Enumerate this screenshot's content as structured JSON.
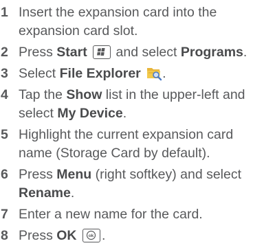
{
  "steps": [
    {
      "num": "1",
      "line1": "Insert the expansion card into the",
      "line2": "expansion card slot."
    },
    {
      "num": "2",
      "pre": "Press ",
      "bold1": "Start",
      "mid": " and select ",
      "bold2": "Programs",
      "post": "."
    },
    {
      "num": "3",
      "pre": "Select ",
      "bold1": "File Explorer",
      "post": "."
    },
    {
      "num": "4",
      "pre": "Tap the ",
      "bold1": "Show",
      "mid": " list in the upper-left and",
      "line2_pre": "select ",
      "line2_bold": "My Device",
      "line2_post": "."
    },
    {
      "num": "5",
      "line1": "Highlight the current expansion card",
      "line2": "name (Storage Card by default)."
    },
    {
      "num": "6",
      "pre": "Press ",
      "bold1": "Menu",
      "mid": " (right softkey) and select",
      "line2_bold": "Rename",
      "line2_post": "."
    },
    {
      "num": "7",
      "line1": "Enter a new name for the card."
    },
    {
      "num": "8",
      "pre": "Press ",
      "bold1": "OK",
      "post": "."
    }
  ],
  "icons": {
    "start_key": "windows-start-key-icon",
    "file_explorer": "file-explorer-folder-icon",
    "ok_key": "ok-key-icon"
  },
  "colors": {
    "text": "#58595b",
    "folder_yellow": "#f2c94c",
    "folder_blue": "#4a79c6"
  }
}
